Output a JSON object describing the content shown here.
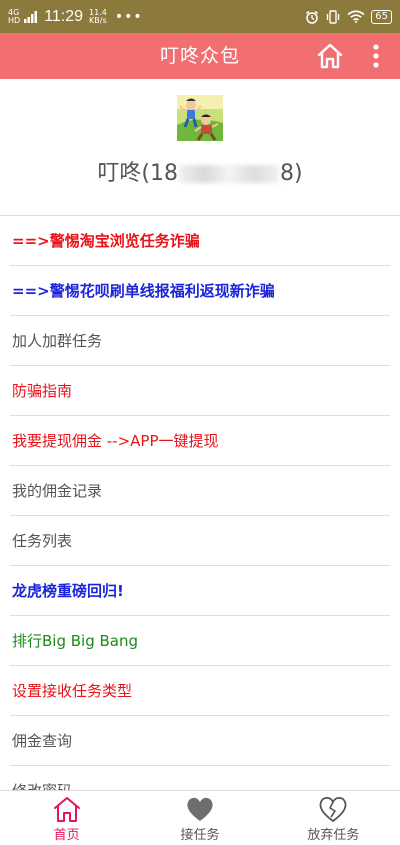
{
  "status_bar": {
    "network_type": "4G",
    "network_sub": "HD",
    "time": "11:29",
    "speed_value": "11.4",
    "speed_unit": "KB/s",
    "dots": "•••",
    "battery": "65"
  },
  "header": {
    "title": "叮咚众包",
    "background": "#f26f71"
  },
  "profile": {
    "name_prefix": "叮咚(18",
    "name_suffix": "8)"
  },
  "menu": {
    "items": [
      {
        "label": "==>警惕淘宝浏览任务诈骗",
        "color": "#e8141a",
        "bold": true
      },
      {
        "label": "==>警惕花呗刷单线报福利返现新诈骗",
        "color": "#1b25d9",
        "bold": true
      },
      {
        "label": "加人加群任务",
        "color": "#555555",
        "bold": false
      },
      {
        "label": "防骗指南",
        "color": "#e8141a",
        "bold": false
      },
      {
        "label": "我要提现佣金 -->APP一键提现",
        "color": "#e8141a",
        "bold": false
      },
      {
        "label": "我的佣金记录",
        "color": "#555555",
        "bold": false
      },
      {
        "label": "任务列表",
        "color": "#555555",
        "bold": false
      },
      {
        "label": "龙虎榜重磅回归!",
        "color": "#1b25d9",
        "bold": true
      },
      {
        "label": "排行Big Big Bang",
        "color": "#1a8a1a",
        "bold": false
      },
      {
        "label": "设置接收任务类型",
        "color": "#e8141a",
        "bold": false
      },
      {
        "label": "佣金查询",
        "color": "#555555",
        "bold": false
      },
      {
        "label": "修改密码",
        "color": "#555555",
        "bold": false
      }
    ]
  },
  "tabbar": {
    "tabs": [
      {
        "label": "首页",
        "icon": "home-icon",
        "active": true,
        "color": "#e8145a"
      },
      {
        "label": "接任务",
        "icon": "heart-filled-icon",
        "active": false,
        "color": "#555555"
      },
      {
        "label": "放弃任务",
        "icon": "heart-broken-icon",
        "active": false,
        "color": "#555555"
      }
    ]
  }
}
